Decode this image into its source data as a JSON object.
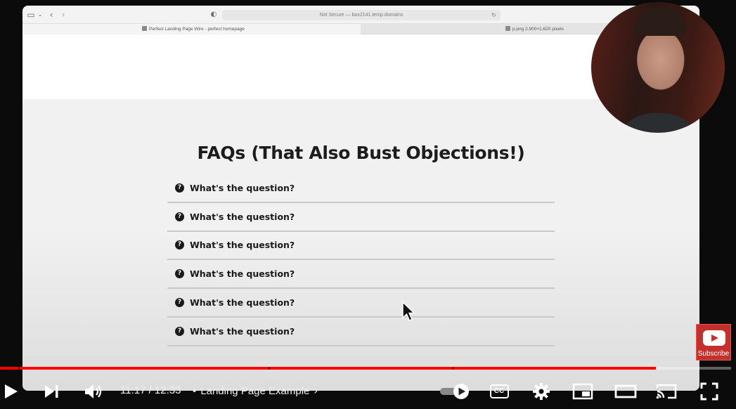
{
  "browser": {
    "address": "Not Secure — box2141.temp.domains",
    "tabs": [
      {
        "label": "Perfect Landing Page Wire - perfect homepage"
      },
      {
        "label": "p.png 2,900×1,620 pixels"
      }
    ]
  },
  "faq": {
    "title": "FAQs (That Also Bust Objections!)",
    "icon_glyph": "?",
    "items": [
      {
        "question": "What's the question?"
      },
      {
        "question": "What's the question?"
      },
      {
        "question": "What's the question?"
      },
      {
        "question": "What's the question?"
      },
      {
        "question": "What's the question?"
      },
      {
        "question": "What's the question?"
      }
    ]
  },
  "subscribe": {
    "label": "Subscribe"
  },
  "player": {
    "time": "11:17 / 12:33",
    "separator": "•",
    "chapter": "Landing Page Example",
    "cc_label": "CC",
    "progress_fraction": 0.897,
    "chapter_marks": [
      0.025,
      0.367,
      0.618
    ],
    "accent_color": "#ff0000"
  }
}
